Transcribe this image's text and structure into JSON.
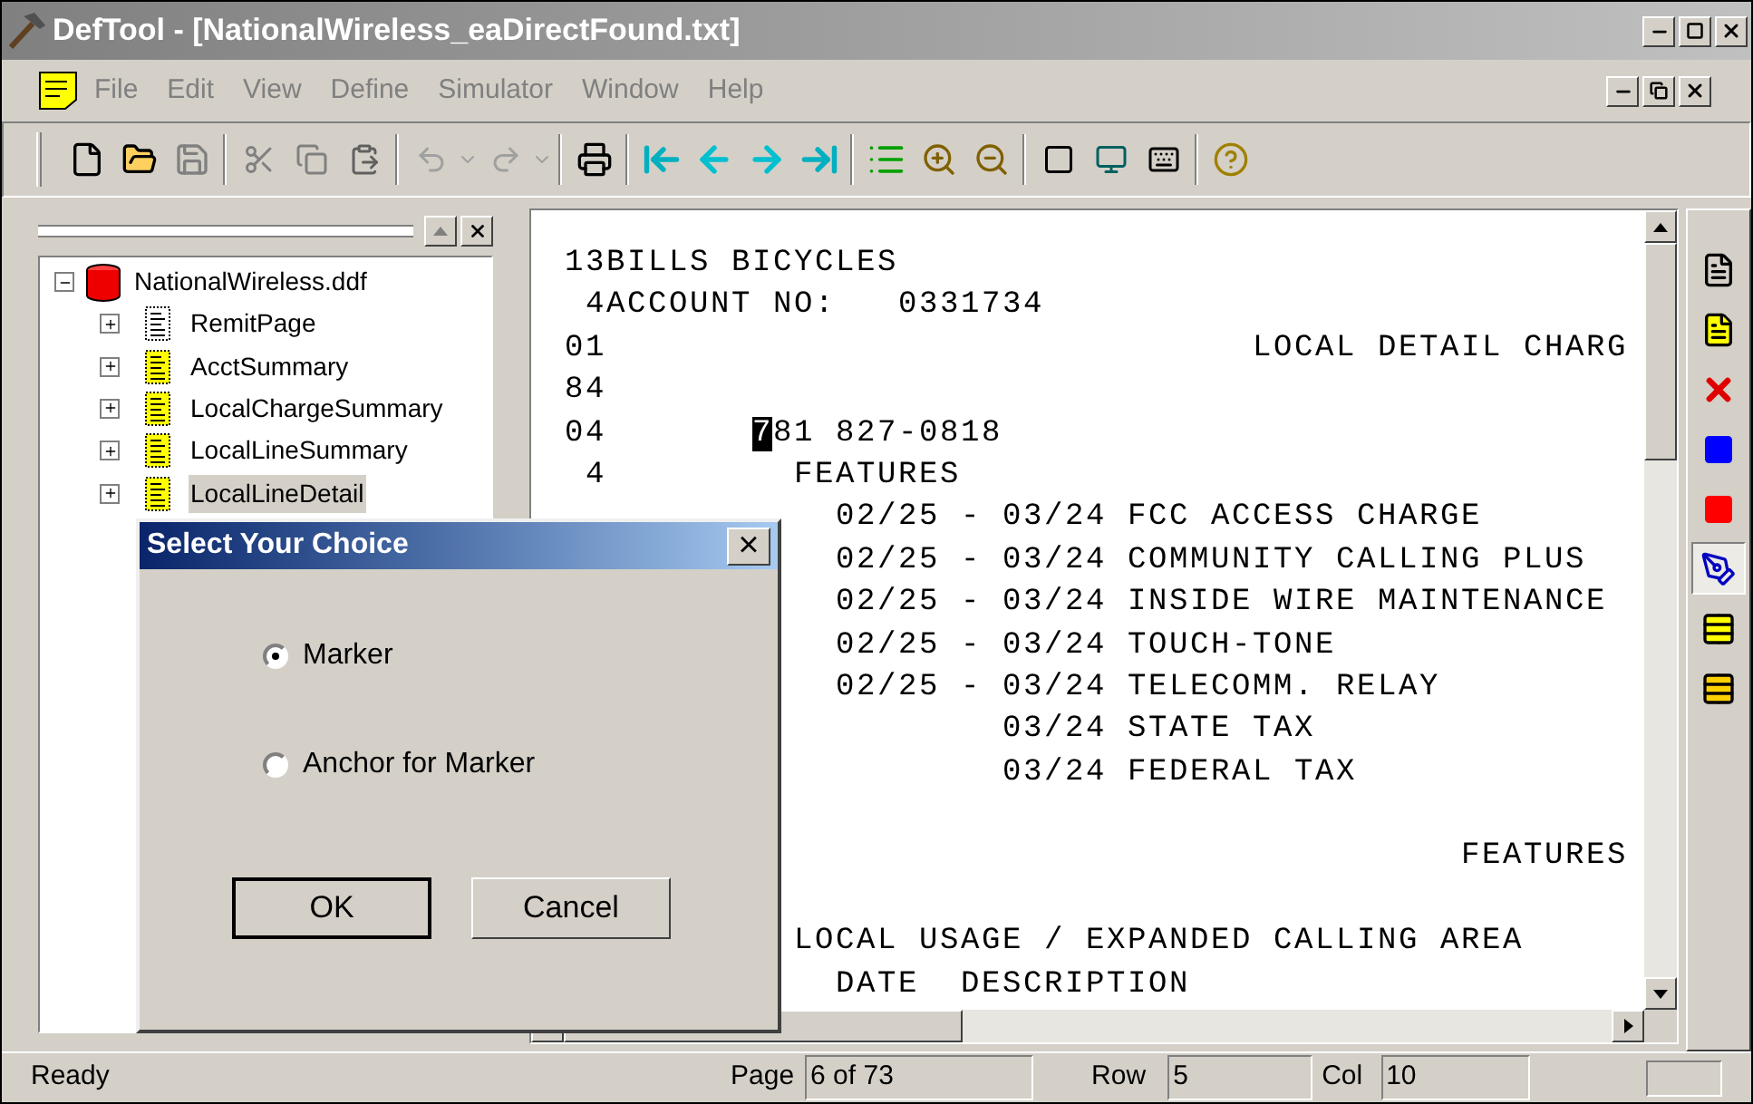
{
  "window": {
    "title": "DefTool - [NationalWireless_eaDirectFound.txt]"
  },
  "menu": [
    "File",
    "Edit",
    "View",
    "Define",
    "Simulator",
    "Window",
    "Help"
  ],
  "tree": {
    "label": "NationalWireless.ddf",
    "expanded": true,
    "selected": false,
    "children": [
      {
        "label": "RemitPage",
        "expanded": false,
        "selected": false,
        "color": "#ffffff"
      },
      {
        "label": "AcctSummary",
        "expanded": false,
        "selected": false,
        "color": "#ffff00"
      },
      {
        "label": "LocalChargeSummary",
        "expanded": false,
        "selected": false,
        "color": "#ffff00"
      },
      {
        "label": "LocalLineSummary",
        "expanded": false,
        "selected": false,
        "color": "#ffff00"
      },
      {
        "label": "LocalLineDetail",
        "expanded": false,
        "selected": true,
        "color": "#ffff00"
      }
    ]
  },
  "document": {
    "lines": [
      {
        "kind": "plain",
        "text": "13BILLS BICYCLES"
      },
      {
        "kind": "plain",
        "text": " 4ACCOUNT NO:   0331734"
      },
      {
        "kind": "title",
        "code": "01",
        "text": "LOCAL DETAIL CHARG"
      },
      {
        "kind": "plain",
        "code": "84"
      },
      {
        "kind": "phone",
        "code": "04",
        "cursor": "7",
        "text": "81 827-0818"
      },
      {
        "kind": "heading",
        "code": "4",
        "text": "FEATURES"
      },
      {
        "kind": "item",
        "text": "02/25 - 03/24 FCC ACCESS CHARGE"
      },
      {
        "kind": "item",
        "text": "02/25 - 03/24 COMMUNITY CALLING PLUS"
      },
      {
        "kind": "item",
        "text": "02/25 - 03/24 INSIDE WIRE MAINTENANCE"
      },
      {
        "kind": "item",
        "text": "02/25 - 03/24 TOUCH-TONE"
      },
      {
        "kind": "item",
        "text": "02/25 - 03/24 TELECOMM. RELAY"
      },
      {
        "kind": "tax",
        "text": "03/24 STATE TAX"
      },
      {
        "kind": "tax",
        "text": "03/24 FEDERAL TAX"
      },
      {
        "kind": "plain"
      },
      {
        "kind": "total",
        "text": "FEATURES"
      },
      {
        "kind": "plain"
      },
      {
        "kind": "heading",
        "text": "LOCAL USAGE / EXPANDED CALLING AREA"
      },
      {
        "kind": "item",
        "text": "DATE  DESCRIPTION"
      }
    ]
  },
  "side_toolbar": [
    {
      "pressed": false
    },
    {
      "pressed": false
    },
    {
      "pressed": false
    },
    {
      "pressed": false
    },
    {
      "pressed": false
    },
    {
      "pressed": true
    },
    {
      "pressed": false
    },
    {
      "pressed": false
    }
  ],
  "dialog": {
    "title": "Select Your Choice",
    "close": "×",
    "options": [
      {
        "label": "Marker",
        "selected": true
      },
      {
        "label": "Anchor for Marker",
        "selected": false
      }
    ],
    "buttons": [
      "OK",
      "Cancel"
    ]
  },
  "status_bar": {
    "message": "Ready",
    "page_label": "Page",
    "page": "6 of 73",
    "row_label": "Row",
    "row": "5",
    "col_label": "Col",
    "col": "10"
  }
}
